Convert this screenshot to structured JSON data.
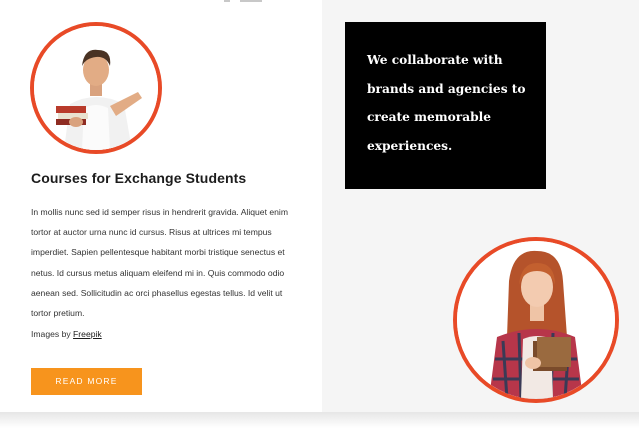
{
  "left": {
    "course_title": "Courses for Exchange Students",
    "body_text": "In mollis nunc sed id semper risus in hendrerit gravida. Aliquet enim tortor at auctor urna nunc id cursus. Risus at ultrices mi tempus imperdiet. Sapien pellentesque habitant morbi tristique senectus et netus. Id cursus metus aliquam eleifend mi in. Quis commodo odio aenean sed. Sollicitudin ac orci phasellus egestas tellus. Id velit ut tortor pretium.",
    "credit_prefix": "Images by ",
    "credit_link": "Freepik",
    "read_more_label": "READ MORE"
  },
  "right": {
    "quote": "We collaborate with brands and agencies to create memorable experiences."
  },
  "colors": {
    "accent_ring": "#e84a27",
    "button": "#f7941d",
    "quote_background": "#000000",
    "right_panel": "#f5f5f5"
  },
  "icons": [
    "student-photo",
    "female-student-photo"
  ]
}
